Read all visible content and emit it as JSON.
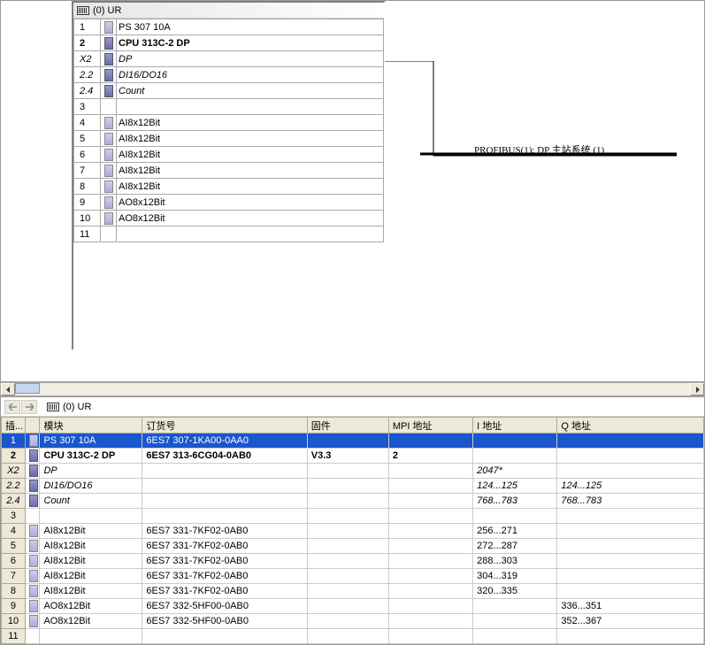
{
  "rackTitle": "(0) UR",
  "profibus": "PROFIBUS(1): DP 主站系统 (1)",
  "rackRows": [
    {
      "slot": "1",
      "icon": true,
      "name": "PS 307 10A",
      "bold": false,
      "italic": false
    },
    {
      "slot": "2",
      "icon": true,
      "name": "CPU 313C-2 DP",
      "bold": true,
      "italic": false,
      "dark": true
    },
    {
      "slot": "X2",
      "icon": true,
      "name": "DP",
      "bold": false,
      "italic": true,
      "dark": true
    },
    {
      "slot": "2.2",
      "icon": true,
      "name": "DI16/DO16",
      "bold": false,
      "italic": true,
      "dark": true
    },
    {
      "slot": "2.4",
      "icon": true,
      "name": "Count",
      "bold": false,
      "italic": true,
      "dark": true
    },
    {
      "slot": "3",
      "icon": false,
      "name": "",
      "bold": false,
      "italic": false
    },
    {
      "slot": "4",
      "icon": true,
      "name": "AI8x12Bit",
      "bold": false,
      "italic": false
    },
    {
      "slot": "5",
      "icon": true,
      "name": "AI8x12Bit",
      "bold": false,
      "italic": false
    },
    {
      "slot": "6",
      "icon": true,
      "name": "AI8x12Bit",
      "bold": false,
      "italic": false
    },
    {
      "slot": "7",
      "icon": true,
      "name": "AI8x12Bit",
      "bold": false,
      "italic": false
    },
    {
      "slot": "8",
      "icon": true,
      "name": "AI8x12Bit",
      "bold": false,
      "italic": false
    },
    {
      "slot": "9",
      "icon": true,
      "name": "AO8x12Bit",
      "bold": false,
      "italic": false
    },
    {
      "slot": "10",
      "icon": true,
      "name": "AO8x12Bit",
      "bold": false,
      "italic": false
    },
    {
      "slot": "11",
      "icon": false,
      "name": "",
      "bold": false,
      "italic": false
    }
  ],
  "detailTitle": "(0)   UR",
  "columns": {
    "slot": "插...",
    "module": "模块",
    "order": "订货号",
    "firmware": "固件",
    "mpi": "MPI 地址",
    "iaddr": "I 地址",
    "qaddr": "Q 地址"
  },
  "detailRows": [
    {
      "slot": "1",
      "icon": true,
      "module": "PS 307 10A",
      "order": "6ES7 307-1KA00-0AA0",
      "fw": "",
      "mpi": "",
      "i": "",
      "q": "",
      "sel": true,
      "bold": false,
      "italic": false
    },
    {
      "slot": "2",
      "icon": true,
      "module": "CPU 313C-2 DP",
      "order": "6ES7 313-6CG04-0AB0",
      "fw": "V3.3",
      "mpi": "2",
      "i": "",
      "q": "",
      "sel": false,
      "bold": true,
      "italic": false,
      "dark": true
    },
    {
      "slot": "X2",
      "icon": true,
      "module": "DP",
      "order": "",
      "fw": "",
      "mpi": "",
      "i": "2047*",
      "q": "",
      "sel": false,
      "bold": false,
      "italic": true,
      "dark": true
    },
    {
      "slot": "2.2",
      "icon": true,
      "module": "DI16/DO16",
      "order": "",
      "fw": "",
      "mpi": "",
      "i": "124...125",
      "q": "124...125",
      "sel": false,
      "bold": false,
      "italic": true,
      "dark": true
    },
    {
      "slot": "2.4",
      "icon": true,
      "module": "Count",
      "order": "",
      "fw": "",
      "mpi": "",
      "i": "768...783",
      "q": "768...783",
      "sel": false,
      "bold": false,
      "italic": true,
      "dark": true
    },
    {
      "slot": "3",
      "icon": false,
      "module": "",
      "order": "",
      "fw": "",
      "mpi": "",
      "i": "",
      "q": "",
      "sel": false,
      "bold": false,
      "italic": false
    },
    {
      "slot": "4",
      "icon": true,
      "module": "AI8x12Bit",
      "order": "6ES7 331-7KF02-0AB0",
      "fw": "",
      "mpi": "",
      "i": "256...271",
      "q": "",
      "sel": false,
      "bold": false,
      "italic": false
    },
    {
      "slot": "5",
      "icon": true,
      "module": "AI8x12Bit",
      "order": "6ES7 331-7KF02-0AB0",
      "fw": "",
      "mpi": "",
      "i": "272...287",
      "q": "",
      "sel": false,
      "bold": false,
      "italic": false
    },
    {
      "slot": "6",
      "icon": true,
      "module": "AI8x12Bit",
      "order": "6ES7 331-7KF02-0AB0",
      "fw": "",
      "mpi": "",
      "i": "288...303",
      "q": "",
      "sel": false,
      "bold": false,
      "italic": false
    },
    {
      "slot": "7",
      "icon": true,
      "module": "AI8x12Bit",
      "order": "6ES7 331-7KF02-0AB0",
      "fw": "",
      "mpi": "",
      "i": "304...319",
      "q": "",
      "sel": false,
      "bold": false,
      "italic": false
    },
    {
      "slot": "8",
      "icon": true,
      "module": "AI8x12Bit",
      "order": "6ES7 331-7KF02-0AB0",
      "fw": "",
      "mpi": "",
      "i": "320...335",
      "q": "",
      "sel": false,
      "bold": false,
      "italic": false
    },
    {
      "slot": "9",
      "icon": true,
      "module": "AO8x12Bit",
      "order": "6ES7 332-5HF00-0AB0",
      "fw": "",
      "mpi": "",
      "i": "",
      "q": "336...351",
      "sel": false,
      "bold": false,
      "italic": false
    },
    {
      "slot": "10",
      "icon": true,
      "module": "AO8x12Bit",
      "order": "6ES7 332-5HF00-0AB0",
      "fw": "",
      "mpi": "",
      "i": "",
      "q": "352...367",
      "sel": false,
      "bold": false,
      "italic": false
    },
    {
      "slot": "11",
      "icon": false,
      "module": "",
      "order": "",
      "fw": "",
      "mpi": "",
      "i": "",
      "q": "",
      "sel": false,
      "bold": false,
      "italic": false
    }
  ]
}
